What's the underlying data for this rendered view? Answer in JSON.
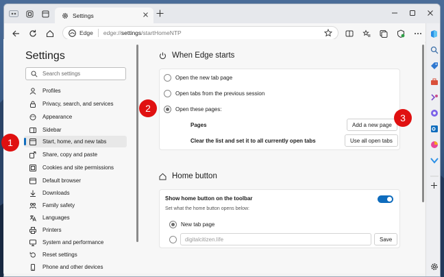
{
  "browser": {
    "tab_title": "Settings",
    "site_label": "Edge",
    "url_scheme": "edge://",
    "url_host": "settings",
    "url_path": "/startHomeNTP"
  },
  "nav": {
    "title": "Settings",
    "search_placeholder": "Search settings",
    "items": [
      {
        "label": "Profiles",
        "icon": "profile-icon"
      },
      {
        "label": "Privacy, search, and services",
        "icon": "lock-icon"
      },
      {
        "label": "Appearance",
        "icon": "appearance-icon"
      },
      {
        "label": "Sidebar",
        "icon": "sidebar-icon"
      },
      {
        "label": "Start, home, and new tabs",
        "icon": "start-home-icon",
        "active": true
      },
      {
        "label": "Share, copy and paste",
        "icon": "share-icon"
      },
      {
        "label": "Cookies and site permissions",
        "icon": "cookies-icon"
      },
      {
        "label": "Default browser",
        "icon": "browser-icon"
      },
      {
        "label": "Downloads",
        "icon": "download-icon"
      },
      {
        "label": "Family safety",
        "icon": "family-icon"
      },
      {
        "label": "Languages",
        "icon": "languages-icon"
      },
      {
        "label": "Printers",
        "icon": "printer-icon"
      },
      {
        "label": "System and performance",
        "icon": "system-icon"
      },
      {
        "label": "Reset settings",
        "icon": "reset-icon"
      },
      {
        "label": "Phone and other devices",
        "icon": "phone-icon"
      }
    ]
  },
  "when_edge_starts": {
    "title": "When Edge starts",
    "option_new_tab": "Open the new tab page",
    "option_prev_session": "Open tabs from the previous session",
    "option_these_pages": "Open these pages:",
    "pages_label": "Pages",
    "add_page_button": "Add a new page",
    "clear_list_label": "Clear the list and set it to all currently open tabs",
    "use_all_tabs_button": "Use all open tabs"
  },
  "home_button": {
    "title": "Home button",
    "show_label": "Show home button on the toolbar",
    "show_enabled": true,
    "description": "Set what the home button opens below:",
    "option_new_tab": "New tab page",
    "url_placeholder": "digitalcitizen.life",
    "save_button": "Save"
  },
  "callouts": [
    "1",
    "2",
    "3"
  ],
  "colors": {
    "accent": "#0f6cbd",
    "callout": "#e01010"
  }
}
